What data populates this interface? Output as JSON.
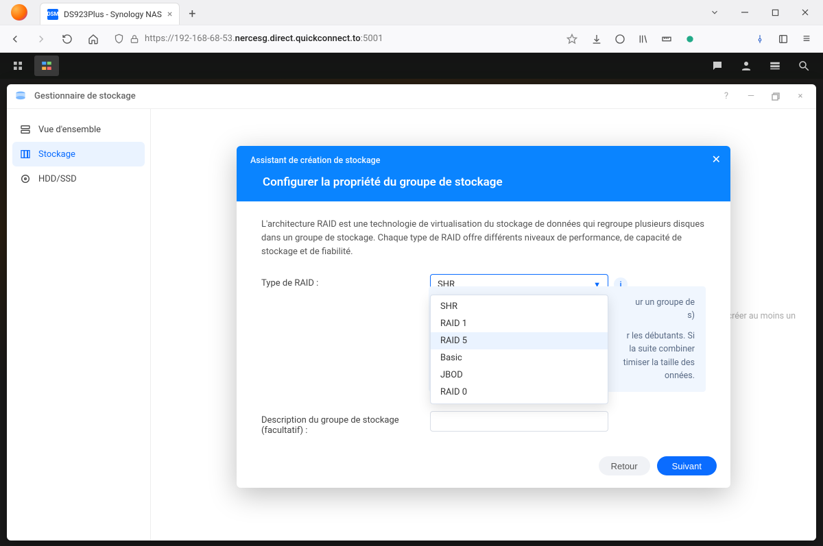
{
  "browser": {
    "tab_title": "DS923Plus - Synology NAS",
    "url_prefix": "https://192-168-68-53.",
    "url_host": "nercesg.direct.quickconnect.to",
    "url_suffix": ":5001"
  },
  "dsm": {
    "storage_manager": {
      "title": "Gestionnaire de stockage",
      "sidebar": {
        "overview": "Vue d'ensemble",
        "storage": "Stockage",
        "hdd_ssd": "HDD/SSD"
      },
      "background_hint": "uillez créer au moins un"
    },
    "dialog": {
      "wizard_label": "Assistant de création de stockage",
      "title": "Configurer la propriété du groupe de stockage",
      "description": "L'architecture RAID est une technologie de virtualisation du stockage de données qui regroupe plusieurs disques dans un groupe de stockage. Chaque type de RAID offre différents niveaux de performance, de capacité de stockage et de fiabilité.",
      "raid_label": "Type de RAID :",
      "raid_selected": "SHR",
      "raid_options": [
        "SHR",
        "RAID 1",
        "RAID 5",
        "Basic",
        "JBOD",
        "RAID 0"
      ],
      "raid_hover_index": 2,
      "info_panel": {
        "line1_tail": "ur un groupe de",
        "line2_tail": "s)",
        "line3_tail": "r les débutants. Si",
        "line4_tail": " la suite combiner",
        "line5_tail": "timiser la taille des",
        "line6_tail": "onnées."
      },
      "desc_label": "Description du groupe de stockage (facultatif) :",
      "back": "Retour",
      "next": "Suivant"
    }
  }
}
